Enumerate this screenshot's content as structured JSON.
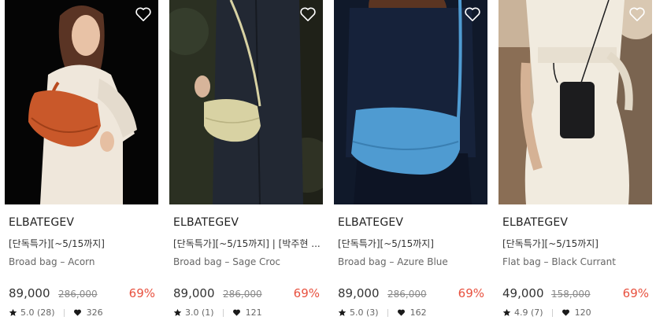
{
  "products": [
    {
      "brand": "ELBATEGEV",
      "promo": "[단독특가][~5/15까지]",
      "name": "Broad bag – Acorn",
      "price": "89,000",
      "original_price": "286,000",
      "discount": "69%",
      "rating": "5.0 (28)",
      "likes": "326",
      "bag_color": "#c9582a"
    },
    {
      "brand": "ELBATEGEV",
      "promo": "[단독특가][~5/15까지] | [박주현 ...",
      "name": "Broad bag – Sage Croc",
      "price": "89,000",
      "original_price": "286,000",
      "discount": "69%",
      "rating": "3.0 (1)",
      "likes": "121",
      "bag_color": "#d8d2a3"
    },
    {
      "brand": "ELBATEGEV",
      "promo": "[단독특가][~5/15까지]",
      "name": "Broad bag – Azure Blue",
      "price": "89,000",
      "original_price": "286,000",
      "discount": "69%",
      "rating": "5.0 (3)",
      "likes": "162",
      "bag_color": "#4f9bd1"
    },
    {
      "brand": "ELBATEGEV",
      "promo": "[단독특가][~5/15까지]",
      "name": "Flat bag – Black Currant",
      "price": "49,000",
      "original_price": "158,000",
      "discount": "69%",
      "rating": "4.9 (7)",
      "likes": "120",
      "bag_color": "#1c1c1e"
    }
  ],
  "icons": {
    "wishlist": "heart-outline-icon",
    "rating": "star-icon",
    "likes": "heart-filled-icon"
  },
  "colors": {
    "discount": "#e8513f",
    "strikethrough": "#8a8a8a"
  }
}
